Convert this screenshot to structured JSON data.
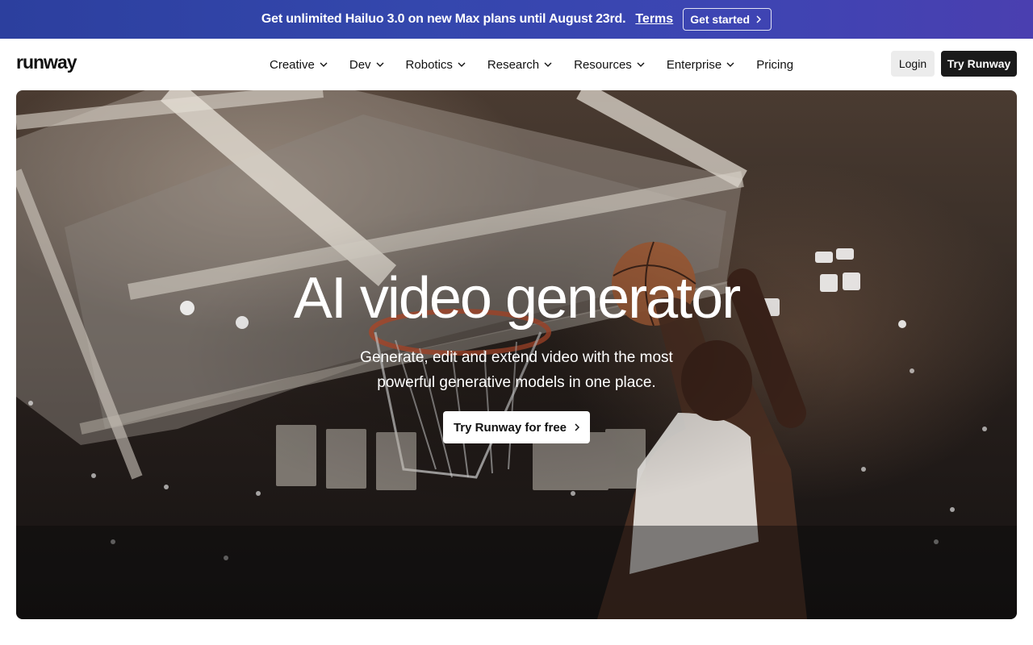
{
  "promo": {
    "text": "Get unlimited Hailuo 3.0 on new Max plans until August 23rd.",
    "terms_label": "Terms",
    "cta_label": "Get started",
    "cta_icon": "chevron-right-icon",
    "background_color": "#3447ad"
  },
  "header": {
    "logo": "runway",
    "nav": [
      {
        "label": "Creative",
        "icon": "chevron-down-icon"
      },
      {
        "label": "Dev",
        "icon": "chevron-down-icon"
      },
      {
        "label": "Robotics",
        "icon": "chevron-down-icon"
      },
      {
        "label": "Research",
        "icon": "chevron-down-icon"
      },
      {
        "label": "Resources",
        "icon": "chevron-down-icon"
      },
      {
        "label": "Enterprise",
        "icon": "chevron-down-icon"
      },
      {
        "label": "Pricing"
      }
    ],
    "login_label": "Login",
    "try_label": "Try Runway"
  },
  "hero": {
    "title": "AI video generator",
    "subtitle": "Generate, edit and extend video with the most powerful generative models in one place.",
    "cta_label": "Try Runway for free",
    "cta_icon": "chevron-right-icon"
  }
}
